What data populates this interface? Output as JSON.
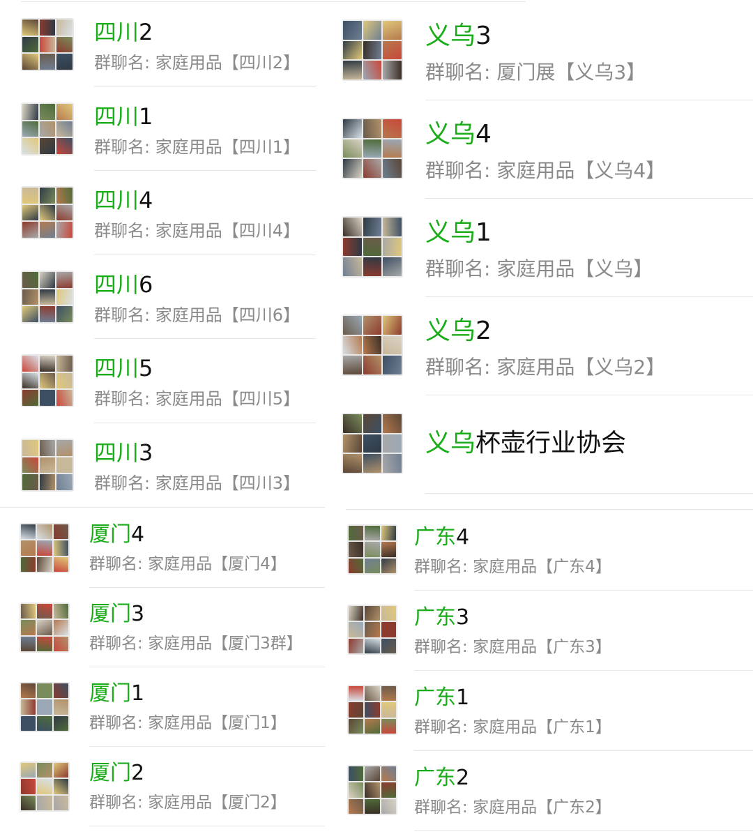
{
  "accent_color": "#1aad19",
  "subtitle_prefix": "群聊名: ",
  "panels": {
    "sichuan": [
      {
        "title_hl": "四川",
        "title_rest": "2",
        "subtitle": "家庭用品【四川2】"
      },
      {
        "title_hl": "四川",
        "title_rest": "1",
        "subtitle": "家庭用品【四川1】"
      },
      {
        "title_hl": "四川",
        "title_rest": "4",
        "subtitle": "家庭用品【四川4】"
      },
      {
        "title_hl": "四川",
        "title_rest": "6",
        "subtitle": "家庭用品【四川6】"
      },
      {
        "title_hl": "四川",
        "title_rest": "5",
        "subtitle": "家庭用品【四川5】"
      },
      {
        "title_hl": "四川",
        "title_rest": "3",
        "subtitle": "家庭用品【四川3】"
      }
    ],
    "yiwu": [
      {
        "title_hl": "义乌",
        "title_rest": "3",
        "subtitle": "厦门展【义乌3】"
      },
      {
        "title_hl": "义乌",
        "title_rest": "4",
        "subtitle": "家庭用品【义乌4】"
      },
      {
        "title_hl": "义乌",
        "title_rest": "1",
        "subtitle": "家庭用品【义乌】"
      },
      {
        "title_hl": "义乌",
        "title_rest": "2",
        "subtitle": "家庭用品【义乌2】"
      },
      {
        "title_hl": "义乌",
        "title_rest": "杯壶行业协会",
        "subtitle": ""
      }
    ],
    "xiamen": [
      {
        "title_hl": "厦门",
        "title_rest": "4",
        "subtitle": "家庭用品【厦门4】"
      },
      {
        "title_hl": "厦门",
        "title_rest": "3",
        "subtitle": "家庭用品【厦门3群】"
      },
      {
        "title_hl": "厦门",
        "title_rest": "1",
        "subtitle": "家庭用品【厦门1】"
      },
      {
        "title_hl": "厦门",
        "title_rest": "2",
        "subtitle": "家庭用品【厦门2】"
      }
    ],
    "guangdong": [
      {
        "title_hl": "广东",
        "title_rest": "4",
        "subtitle": "家庭用品【广东4】"
      },
      {
        "title_hl": "广东",
        "title_rest": "3",
        "subtitle": "家庭用品【广东3】"
      },
      {
        "title_hl": "广东",
        "title_rest": "1",
        "subtitle": "家庭用品【广东1】"
      },
      {
        "title_hl": "广东",
        "title_rest": "2",
        "subtitle": "家庭用品【广东2】"
      }
    ]
  }
}
